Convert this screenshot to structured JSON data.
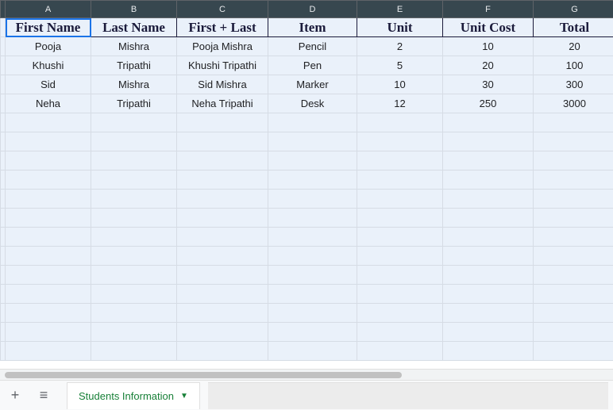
{
  "columns": [
    "A",
    "B",
    "C",
    "D",
    "E",
    "F",
    "G"
  ],
  "headerRow": [
    "First Name",
    "Last Name",
    "First + Last",
    "Item",
    "Unit",
    "Unit Cost",
    "Total"
  ],
  "rows": [
    [
      "Pooja",
      "Mishra",
      "Pooja Mishra",
      "Pencil",
      "2",
      "10",
      "20"
    ],
    [
      "Khushi",
      "Tripathi",
      "Khushi Tripathi",
      "Pen",
      "5",
      "20",
      "100"
    ],
    [
      "Sid",
      "Mishra",
      "Sid Mishra",
      "Marker",
      "10",
      "30",
      "300"
    ],
    [
      "Neha",
      "Tripathi",
      "Neha Tripathi",
      "Desk",
      "12",
      "250",
      "3000"
    ]
  ],
  "emptyRowCount": 13,
  "selectedCell": {
    "row": 0,
    "col": 0
  },
  "tabbar": {
    "addTooltip": "Add sheet",
    "allSheetsTooltip": "All sheets",
    "activeTab": "Students Information"
  },
  "chart_data": {
    "type": "table",
    "title": "Students Information",
    "columns": [
      "First Name",
      "Last Name",
      "First + Last",
      "Item",
      "Unit",
      "Unit Cost",
      "Total"
    ],
    "records": [
      {
        "First Name": "Pooja",
        "Last Name": "Mishra",
        "First + Last": "Pooja Mishra",
        "Item": "Pencil",
        "Unit": 2,
        "Unit Cost": 10,
        "Total": 20
      },
      {
        "First Name": "Khushi",
        "Last Name": "Tripathi",
        "First + Last": "Khushi Tripathi",
        "Item": "Pen",
        "Unit": 5,
        "Unit Cost": 20,
        "Total": 100
      },
      {
        "First Name": "Sid",
        "Last Name": "Mishra",
        "First + Last": "Sid Mishra",
        "Item": "Marker",
        "Unit": 10,
        "Unit Cost": 30,
        "Total": 300
      },
      {
        "First Name": "Neha",
        "Last Name": "Tripathi",
        "First + Last": "Neha Tripathi",
        "Item": "Desk",
        "Unit": 12,
        "Unit Cost": 250,
        "Total": 3000
      }
    ]
  }
}
